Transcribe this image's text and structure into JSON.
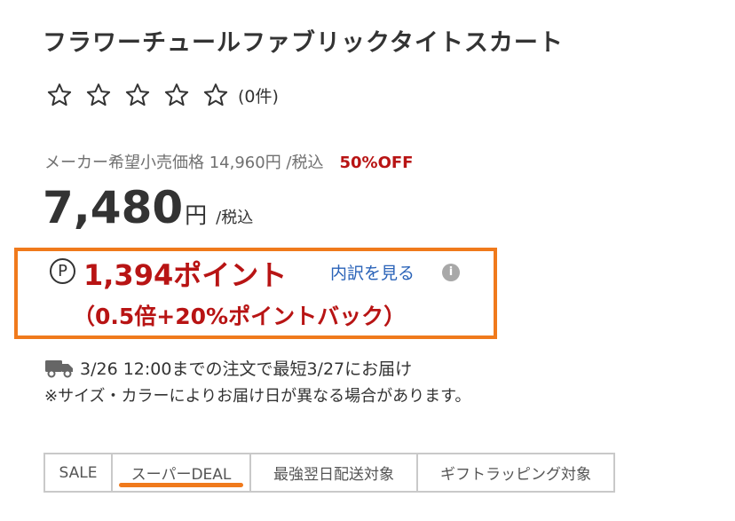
{
  "product": {
    "title": "フラワーチュールファブリックタイトスカート",
    "review_count": "(0件)"
  },
  "pricing": {
    "msrp_text": "メーカー希望小売価格 14,960円 /税込",
    "discount": "50%OFF",
    "price": "7,480",
    "price_unit": "円",
    "tax_note": "/税込"
  },
  "points": {
    "icon_label": "P",
    "amount_text": "1,394ポイント",
    "breakdown_link": "内訳を見る",
    "info_icon": "i",
    "multiplier_text": "（0.5倍+20%ポイントバック）"
  },
  "delivery": {
    "text": "3/26 12:00までの注文で最短3/27にお届け",
    "note": "※サイズ・カラーによりお届け日が異なる場合があります。"
  },
  "tags": {
    "sale": "SALE",
    "deal": "スーパーDEAL",
    "next_day": "最強翌日配送対象",
    "gift": "ギフトラッピング対象"
  },
  "colors": {
    "accent_red": "#b81414",
    "highlight_orange": "#f07a1c",
    "link_blue": "#2a63b8"
  },
  "icons": [
    "star-outline-icon",
    "points-icon",
    "info-icon",
    "truck-icon"
  ]
}
